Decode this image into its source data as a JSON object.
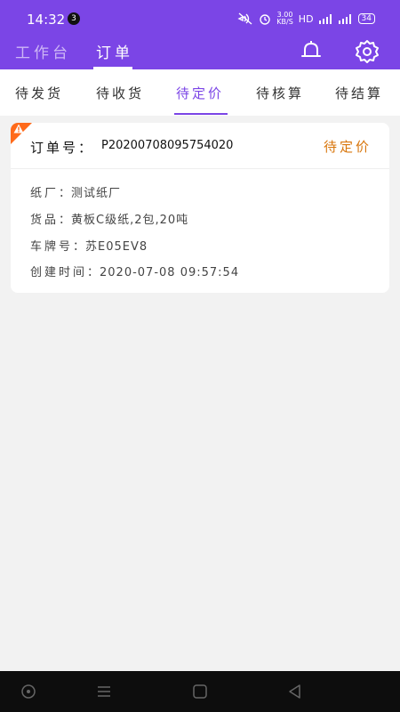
{
  "status_bar": {
    "time": "14:32",
    "notification_count": "3",
    "speed_value": "3.00",
    "speed_unit": "KB/S",
    "hd_label": "HD",
    "battery": "34"
  },
  "header": {
    "tabs": [
      {
        "label": "工作台"
      },
      {
        "label": "订单"
      }
    ]
  },
  "sub_tabs": [
    {
      "label": "待发货"
    },
    {
      "label": "待收货"
    },
    {
      "label": "待定价"
    },
    {
      "label": "待核算"
    },
    {
      "label": "待结算"
    }
  ],
  "order": {
    "no_label": "订单号：",
    "no_value": "P20200708095754020",
    "status": "待定价",
    "rows": [
      {
        "label": "纸厂",
        "value": "：测试纸厂"
      },
      {
        "label": "货品",
        "value": "：黄板C级纸,2包,20吨"
      },
      {
        "label": "车牌号",
        "value": "：苏E05EV8"
      },
      {
        "label": "创建时间",
        "value": "：2020-07-08 09:57:54"
      }
    ]
  },
  "colors": {
    "brand": "#7b45e6",
    "status": "#d8760c",
    "warning": "#ff6a1a"
  }
}
